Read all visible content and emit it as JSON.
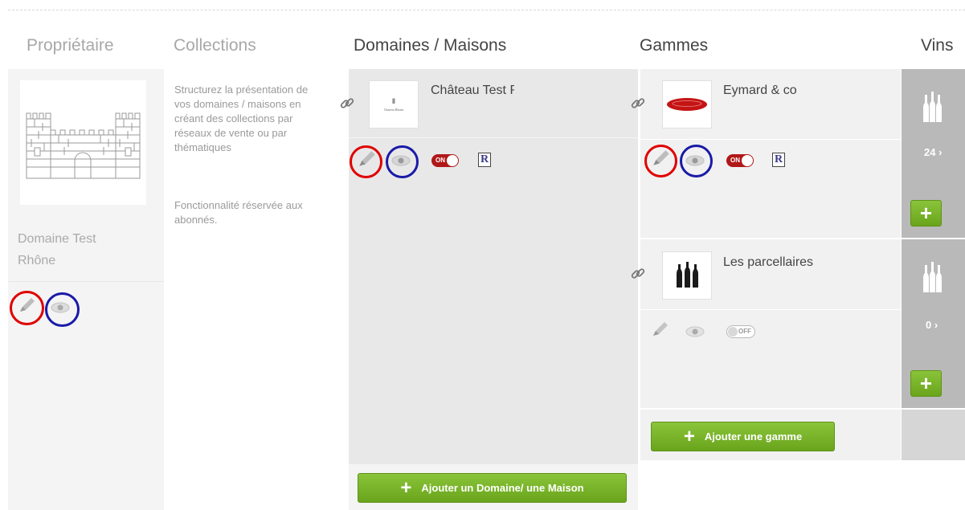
{
  "columns": {
    "proprietaire": "Propriétaire",
    "collections": "Collections",
    "domaines": "Domaines / Maisons",
    "gammes": "Gammes",
    "vins": "Vins"
  },
  "owner": {
    "name": "Domaine Test Rhône"
  },
  "collections_info": {
    "description": "Structurez la présentation de vos domaines / maisons en créant des collections par réseaux de vente ou par thématiques",
    "note": "Fonctionnalité réservée aux abonnés."
  },
  "domaine": {
    "name": "Château Test Rhône",
    "toggle_label": "ON",
    "badge": "R",
    "add_button_label": "Ajouter un Domaine/ une Maison"
  },
  "gammes": [
    {
      "name": "Eymard & co",
      "toggle_label": "ON",
      "badge": "R",
      "wine_count": "24 ›"
    },
    {
      "name": "Les parcellaires",
      "toggle_label": "OFF",
      "wine_count": "0 ›"
    }
  ],
  "gamme_add_button_label": "Ajouter une gamme",
  "colors": {
    "accent_green": "#7ab32e",
    "annotation_red": "#e00000",
    "annotation_blue": "#1a1aa8",
    "toggle_on_red": "#b01818"
  }
}
